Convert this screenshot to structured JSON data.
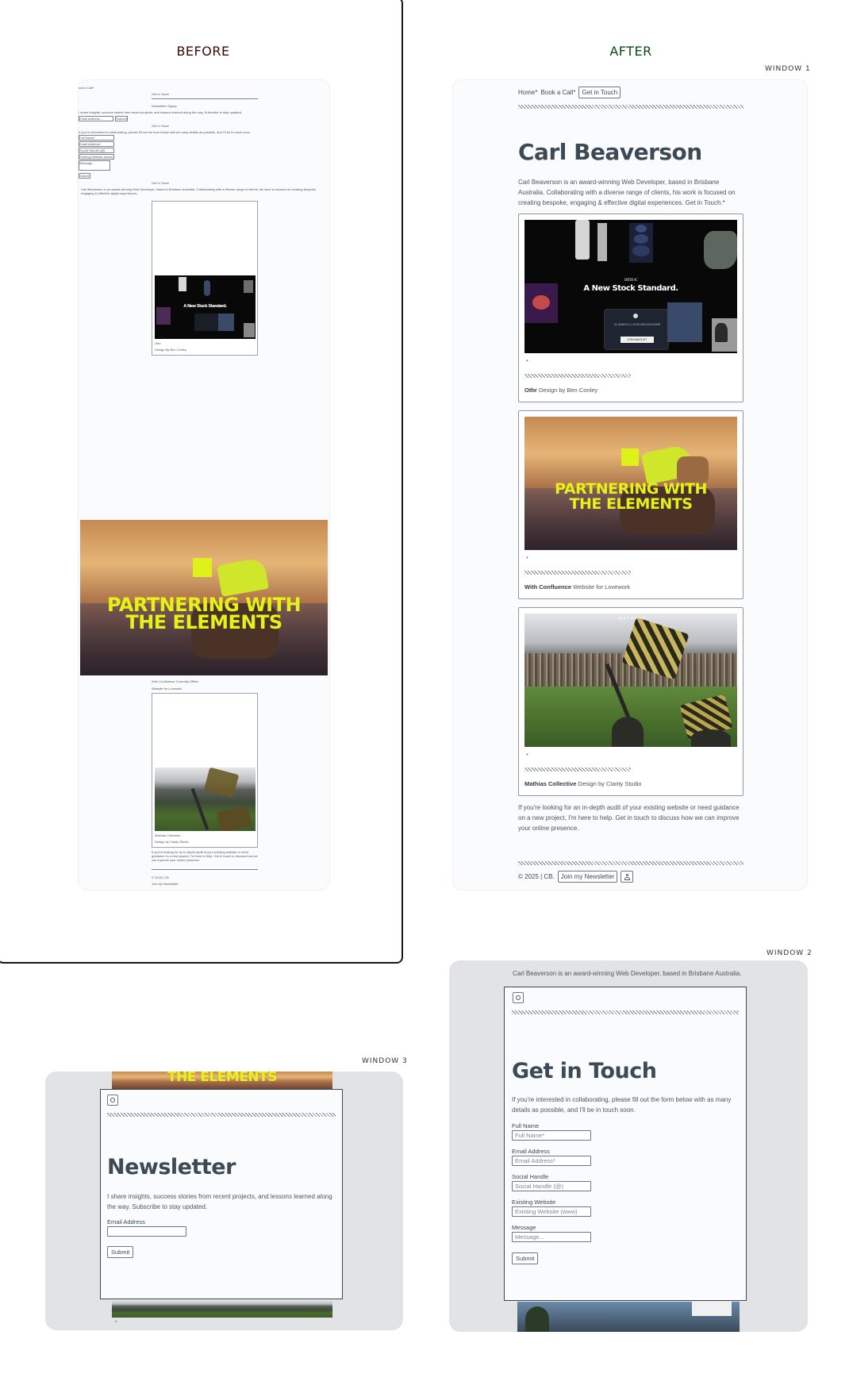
{
  "labels": {
    "before": "BEFORE",
    "after": "AFTER",
    "window1": "WINDOW 1",
    "window2": "WINDOW 2",
    "window3": "WINDOW 3"
  },
  "colors": {
    "before_title": "#3a0a0a",
    "after_title": "#0c4a1a",
    "neon": "#e4f21a",
    "text": "#3c4a55"
  },
  "before": {
    "book_call": "ook a Call*",
    "get_in_touch_1": "Get in Touch",
    "newsletter_signup": "Newsletter Signup",
    "newsletter_text": "I share insights, success stories from recent projects, and lessons learned along the way. Subscribe to stay updated.",
    "email_placeholder": "Email Address...",
    "subscribe": "Subscribe",
    "get_in_touch_2": "Get in Touch",
    "contact_text": "If you're interested in collaborating, please fill out the form below with as many details as possible, and I'll be in touch soon.",
    "fields": [
      "Full Name*",
      "Email Address*",
      "Social Handle (@)",
      "Existing Website (www)",
      "Message..."
    ],
    "submit": "Submit",
    "get_in_touch_3": "Get in Touch",
    "bio": "Carl Beaverson is an award-winning Web Developer, based in Brisbane Australia. Collaborating with a diverse range of clients, his work is focused on creating bespoke, engaging & effective digital experiences.",
    "othr_name": "Othr",
    "othr_credit": "Design By Ben Conley",
    "confluence_name": "Web Confluence Currently Offline",
    "confluence_credit": "Website for Lovework",
    "mathias_name": "Mathias Collective",
    "mathias_credit": "Design by Clarity Studio",
    "cta": "If you're looking for an in-depth audit of your existing website or need guidance on a new project, I'm here to help. Get in touch to discuss how we can improve your online presence.",
    "copyright": "© 2025 | CB",
    "join": "Join My Newsletter"
  },
  "after": {
    "nav": {
      "home": "Home*",
      "book": "Book a Call*",
      "touch": "Get in Touch"
    },
    "title": "Carl Beaverson",
    "bio": "Carl Beaverson is an award-winning Web Developer, based in Brisbane Australia. Collaborating with a diverse range of clients, his work is focused on creating bespoke, engaging & effective digital experiences. Get in Touch.*",
    "projects": [
      {
        "name": "Othr",
        "credit": "Design by Ben Conley"
      },
      {
        "name": "With Confluence",
        "credit": "Website for Lovework"
      },
      {
        "name": "Mathias Collective",
        "credit": "Design by Clarity Studio"
      }
    ],
    "project_marker": "*",
    "othr_image": {
      "small": "ENTER AC",
      "headline": "A New Stock Standard.",
      "card_text": "01 MARCH | 2025 MELBOURNE",
      "card_button": "JOIN WAITLIST"
    },
    "solar_image": {
      "line1": "PARTNERING WITH",
      "line2": "THE ELEMENTS"
    },
    "stadium_image": {
      "brand": "MATHIAS"
    },
    "cta": "If you're looking for an in-depth audit of your existing website or need guidance on a new project, I'm here to help. Get in touch to discuss how we can improve your online presence.",
    "footer": {
      "copyright": "© 2025 | CB.",
      "join": "Join my Newsletter"
    }
  },
  "window2": {
    "behind_text": "Carl Beaverson is an award-winning Web Developer, based in Brisbane Australia.",
    "title": "Get in Touch",
    "intro": "If you're interested in collaborating, please fill out the form below with as many details as possible, and I'll be in touch soon.",
    "fields": [
      {
        "label": "Full Name",
        "placeholder": "Full Name*"
      },
      {
        "label": "Email Address",
        "placeholder": "Email Address*"
      },
      {
        "label": "Social Handle",
        "placeholder": "Social Handle (@)"
      },
      {
        "label": "Existing Website",
        "placeholder": "Existing Website (www)"
      },
      {
        "label": "Message",
        "placeholder": "Message..."
      }
    ],
    "submit": "Submit"
  },
  "window3": {
    "behind_text": "THE ELEMENTS",
    "title": "Newsletter",
    "intro": "I share insights, success stories from recent projects, and lessons learned along the way. Subscribe to stay updated.",
    "email_label": "Email Address",
    "email_value": "",
    "submit": "Submit",
    "marker": "*"
  }
}
